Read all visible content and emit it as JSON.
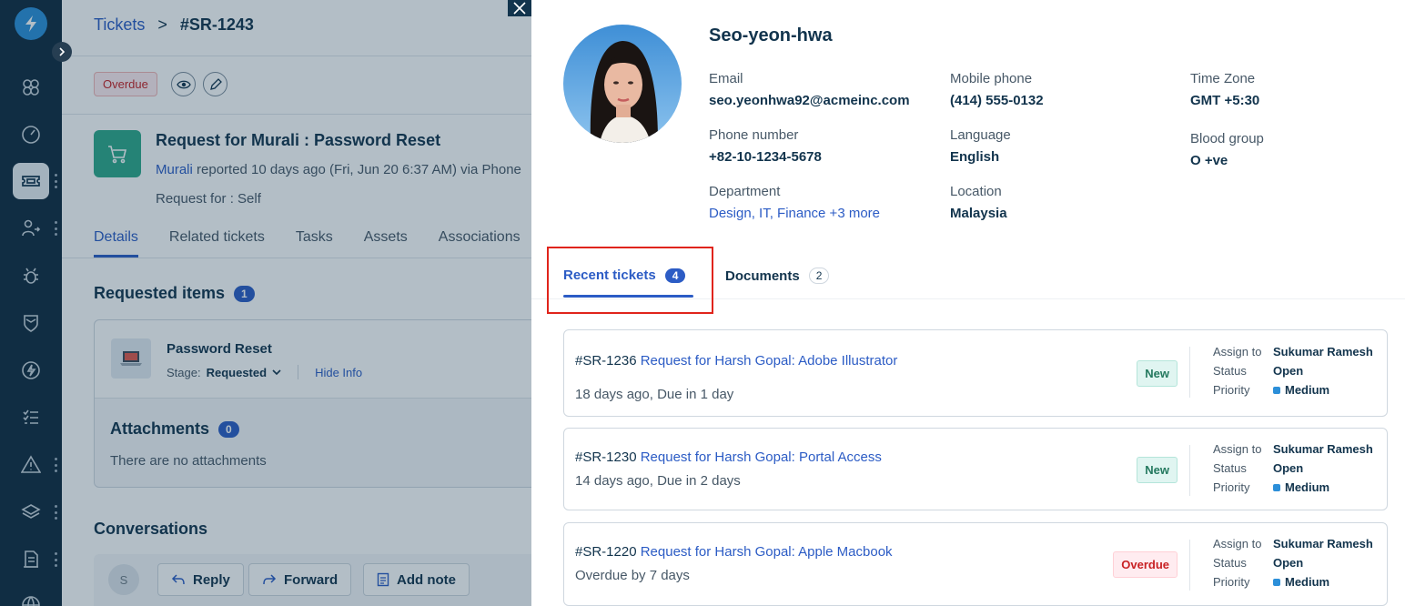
{
  "nav": {
    "items": [
      "logo-bolt",
      "mind-map",
      "dashboard",
      "tickets",
      "user-swap",
      "bug",
      "shield",
      "bolt-circle",
      "task-list",
      "warning",
      "layers",
      "document",
      "globe"
    ]
  },
  "ticket": {
    "breadcrumb": {
      "parent": "Tickets",
      "separator": ">",
      "current": "#SR-1243"
    },
    "status_badge": "Overdue",
    "title": "Request for Murali : Password Reset",
    "requester": "Murali",
    "meta_text": "reported 10 days ago (Fri, Jun 20 6:37 AM) via Phone",
    "request_for": "Request for :  Self",
    "tabs": [
      "Details",
      "Related tickets",
      "Tasks",
      "Assets",
      "Associations"
    ],
    "requested_items": {
      "title": "Requested items",
      "count": "1"
    },
    "item": {
      "name": "Password Reset",
      "stage_label": "Stage:",
      "stage_value": "Requested",
      "hide_info": "Hide Info"
    },
    "attachments": {
      "title": "Attachments",
      "count": "0",
      "empty": "There are no attachments"
    },
    "conversations": {
      "title": "Conversations",
      "avatar_initial": "S",
      "reply": "Reply",
      "forward": "Forward",
      "add_note": "Add note"
    }
  },
  "profile": {
    "name": "Seo-yeon-hwa",
    "email": {
      "label": "Email",
      "value": "seo.yeonhwa92@acmeinc.com"
    },
    "mobile": {
      "label": "Mobile phone",
      "value": "(414) 555-0132"
    },
    "timezone": {
      "label": "Time Zone",
      "value": "GMT +5:30"
    },
    "phone": {
      "label": "Phone number",
      "value": "+82-10-1234-5678"
    },
    "language": {
      "label": "Language",
      "value": "English"
    },
    "blood": {
      "label": "Blood group",
      "value": "O +ve"
    },
    "department": {
      "label": "Department",
      "value": "Design, IT, Finance +3 more"
    },
    "location": {
      "label": "Location",
      "value": "Malaysia"
    }
  },
  "drawer_tabs": {
    "recent": {
      "label": "Recent tickets",
      "count": "4"
    },
    "documents": {
      "label": "Documents",
      "count": "2"
    }
  },
  "ticket_cards": [
    {
      "id": "#SR-1236",
      "title": "Request for Harsh Gopal: Adobe Illustrator",
      "sub": "18 days ago, Due in 1 day",
      "status": "New",
      "assign_label": "Assign to",
      "assign": "Sukumar Ramesh",
      "status_label": "Status",
      "state": "Open",
      "priority_label": "Priority",
      "priority": "Medium"
    },
    {
      "id": "#SR-1230",
      "title": "Request for Harsh Gopal: Portal Access",
      "sub": "14 days ago, Due in 2 days",
      "status": "New",
      "assign_label": "Assign to",
      "assign": "Sukumar Ramesh",
      "status_label": "Status",
      "state": "Open",
      "priority_label": "Priority",
      "priority": "Medium"
    },
    {
      "id": "#SR-1220",
      "title": "Request for Harsh Gopal: Apple Macbook",
      "sub": "Overdue by 7 days",
      "status": "Overdue",
      "assign_label": "Assign to",
      "assign": "Sukumar Ramesh",
      "status_label": "Status",
      "state": "Open",
      "priority_label": "Priority",
      "priority": "Medium"
    }
  ],
  "colors": {
    "accent": "#2c5cc5",
    "nav_bg": "#0f2a3e",
    "highlight": "#e0241b",
    "new": "#24795f",
    "overdue": "#c82124"
  }
}
